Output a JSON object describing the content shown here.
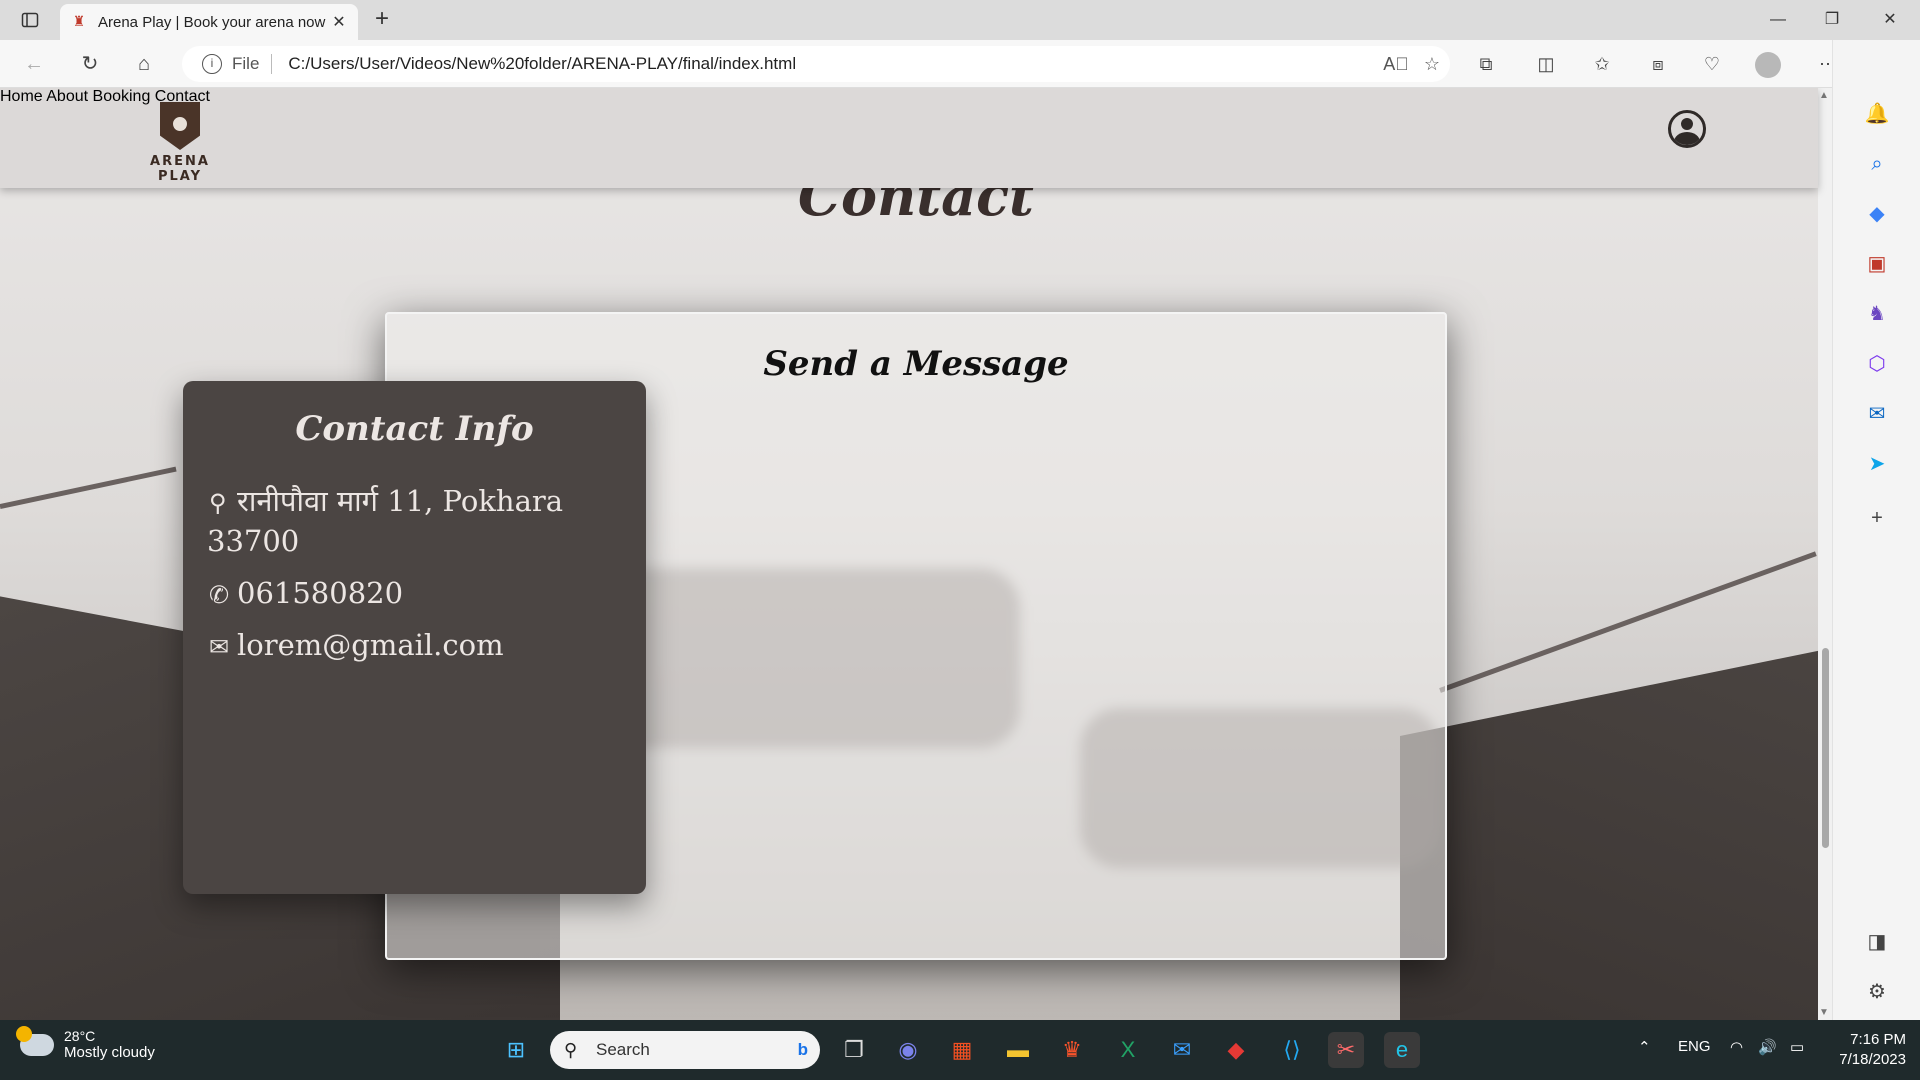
{
  "browser": {
    "tab_title": "Arena Play | Book your arena now",
    "url_scheme": "File",
    "url": "C:/Users/User/Videos/New%20folder/ARENA-PLAY/final/index.html"
  },
  "site": {
    "brand": "ARENA PLAY",
    "nav": [
      "Home",
      "About",
      "Booking",
      "Contact"
    ],
    "section_title": "Contact",
    "message_card_title": "Send a Message",
    "info_card": {
      "title": "Contact Info",
      "address_line1": "रानीपौवा मार्ग 11, Pokhara",
      "address_line2": "33700",
      "phone": "061580820",
      "email": "lorem@gmail.com"
    }
  },
  "taskbar": {
    "weather_temp": "28°C",
    "weather_desc": "Mostly cloudy",
    "search_placeholder": "Search",
    "language": "ENG",
    "time": "7:16 PM",
    "date": "7/18/2023"
  },
  "colors": {
    "header_bg": "#dcd9d8",
    "info_card_bg": "#4b4543",
    "taskbar_bg": "#1f2a2c"
  }
}
